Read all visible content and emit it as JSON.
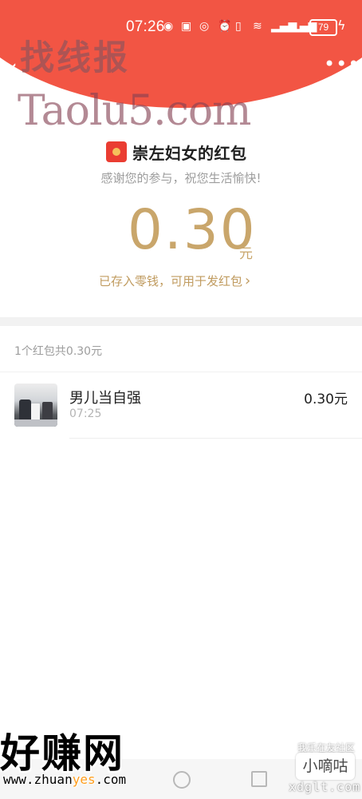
{
  "status": {
    "time": "07:26",
    "battery": "79"
  },
  "watermarks": {
    "top_text": "找线报",
    "top_url": "Taolu5.com",
    "bottom_text": "好赚网",
    "bottom_url_prefix": "www.zhuan",
    "bottom_url_accent": "yes",
    "bottom_url_suffix": ".com",
    "brand_small": "我乐在友社区",
    "brand_box": "小嘀咕",
    "brand_url": "xdglt.com"
  },
  "packet": {
    "sender": "崇左妇女的红包",
    "blessing": "感谢您的参与，祝您生活愉快!",
    "amount": "0.30",
    "unit": "元",
    "saved_link": "已存入零钱，可用于发红包",
    "summary": "1个红包共0.30元"
  },
  "rows": [
    {
      "name": "男儿当自强",
      "time": "07:25",
      "amount": "0.30元"
    }
  ],
  "icons": {
    "back": "chevron-left-icon",
    "more": "more-icon",
    "red_packet": "red-packet-icon",
    "wifi": "wifi-icon",
    "signal": "signal-icon",
    "battery": "battery-icon",
    "charging": "bolt-icon"
  }
}
